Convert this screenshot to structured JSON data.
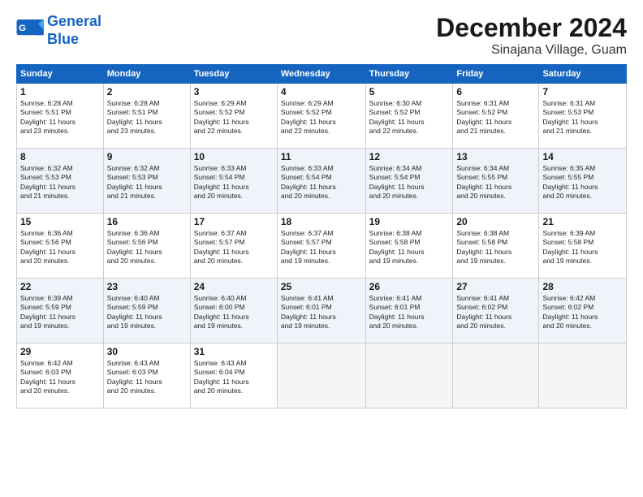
{
  "header": {
    "logo_line1": "General",
    "logo_line2": "Blue",
    "month": "December 2024",
    "location": "Sinajana Village, Guam"
  },
  "weekdays": [
    "Sunday",
    "Monday",
    "Tuesday",
    "Wednesday",
    "Thursday",
    "Friday",
    "Saturday"
  ],
  "weeks": [
    [
      {
        "day": "1",
        "info": "Sunrise: 6:28 AM\nSunset: 5:51 PM\nDaylight: 11 hours\nand 23 minutes."
      },
      {
        "day": "2",
        "info": "Sunrise: 6:28 AM\nSunset: 5:51 PM\nDaylight: 11 hours\nand 23 minutes."
      },
      {
        "day": "3",
        "info": "Sunrise: 6:29 AM\nSunset: 5:52 PM\nDaylight: 11 hours\nand 22 minutes."
      },
      {
        "day": "4",
        "info": "Sunrise: 6:29 AM\nSunset: 5:52 PM\nDaylight: 11 hours\nand 22 minutes."
      },
      {
        "day": "5",
        "info": "Sunrise: 6:30 AM\nSunset: 5:52 PM\nDaylight: 11 hours\nand 22 minutes."
      },
      {
        "day": "6",
        "info": "Sunrise: 6:31 AM\nSunset: 5:52 PM\nDaylight: 11 hours\nand 21 minutes."
      },
      {
        "day": "7",
        "info": "Sunrise: 6:31 AM\nSunset: 5:53 PM\nDaylight: 11 hours\nand 21 minutes."
      }
    ],
    [
      {
        "day": "8",
        "info": "Sunrise: 6:32 AM\nSunset: 5:53 PM\nDaylight: 11 hours\nand 21 minutes."
      },
      {
        "day": "9",
        "info": "Sunrise: 6:32 AM\nSunset: 5:53 PM\nDaylight: 11 hours\nand 21 minutes."
      },
      {
        "day": "10",
        "info": "Sunrise: 6:33 AM\nSunset: 5:54 PM\nDaylight: 11 hours\nand 20 minutes."
      },
      {
        "day": "11",
        "info": "Sunrise: 6:33 AM\nSunset: 5:54 PM\nDaylight: 11 hours\nand 20 minutes."
      },
      {
        "day": "12",
        "info": "Sunrise: 6:34 AM\nSunset: 5:54 PM\nDaylight: 11 hours\nand 20 minutes."
      },
      {
        "day": "13",
        "info": "Sunrise: 6:34 AM\nSunset: 5:55 PM\nDaylight: 11 hours\nand 20 minutes."
      },
      {
        "day": "14",
        "info": "Sunrise: 6:35 AM\nSunset: 5:55 PM\nDaylight: 11 hours\nand 20 minutes."
      }
    ],
    [
      {
        "day": "15",
        "info": "Sunrise: 6:36 AM\nSunset: 5:56 PM\nDaylight: 11 hours\nand 20 minutes."
      },
      {
        "day": "16",
        "info": "Sunrise: 6:36 AM\nSunset: 5:56 PM\nDaylight: 11 hours\nand 20 minutes."
      },
      {
        "day": "17",
        "info": "Sunrise: 6:37 AM\nSunset: 5:57 PM\nDaylight: 11 hours\nand 20 minutes."
      },
      {
        "day": "18",
        "info": "Sunrise: 6:37 AM\nSunset: 5:57 PM\nDaylight: 11 hours\nand 19 minutes."
      },
      {
        "day": "19",
        "info": "Sunrise: 6:38 AM\nSunset: 5:58 PM\nDaylight: 11 hours\nand 19 minutes."
      },
      {
        "day": "20",
        "info": "Sunrise: 6:38 AM\nSunset: 5:58 PM\nDaylight: 11 hours\nand 19 minutes."
      },
      {
        "day": "21",
        "info": "Sunrise: 6:39 AM\nSunset: 5:58 PM\nDaylight: 11 hours\nand 19 minutes."
      }
    ],
    [
      {
        "day": "22",
        "info": "Sunrise: 6:39 AM\nSunset: 5:59 PM\nDaylight: 11 hours\nand 19 minutes."
      },
      {
        "day": "23",
        "info": "Sunrise: 6:40 AM\nSunset: 5:59 PM\nDaylight: 11 hours\nand 19 minutes."
      },
      {
        "day": "24",
        "info": "Sunrise: 6:40 AM\nSunset: 6:00 PM\nDaylight: 11 hours\nand 19 minutes."
      },
      {
        "day": "25",
        "info": "Sunrise: 6:41 AM\nSunset: 6:01 PM\nDaylight: 11 hours\nand 19 minutes."
      },
      {
        "day": "26",
        "info": "Sunrise: 6:41 AM\nSunset: 6:01 PM\nDaylight: 11 hours\nand 20 minutes."
      },
      {
        "day": "27",
        "info": "Sunrise: 6:41 AM\nSunset: 6:02 PM\nDaylight: 11 hours\nand 20 minutes."
      },
      {
        "day": "28",
        "info": "Sunrise: 6:42 AM\nSunset: 6:02 PM\nDaylight: 11 hours\nand 20 minutes."
      }
    ],
    [
      {
        "day": "29",
        "info": "Sunrise: 6:42 AM\nSunset: 6:03 PM\nDaylight: 11 hours\nand 20 minutes."
      },
      {
        "day": "30",
        "info": "Sunrise: 6:43 AM\nSunset: 6:03 PM\nDaylight: 11 hours\nand 20 minutes."
      },
      {
        "day": "31",
        "info": "Sunrise: 6:43 AM\nSunset: 6:04 PM\nDaylight: 11 hours\nand 20 minutes."
      },
      {
        "day": "",
        "info": ""
      },
      {
        "day": "",
        "info": ""
      },
      {
        "day": "",
        "info": ""
      },
      {
        "day": "",
        "info": ""
      }
    ]
  ]
}
